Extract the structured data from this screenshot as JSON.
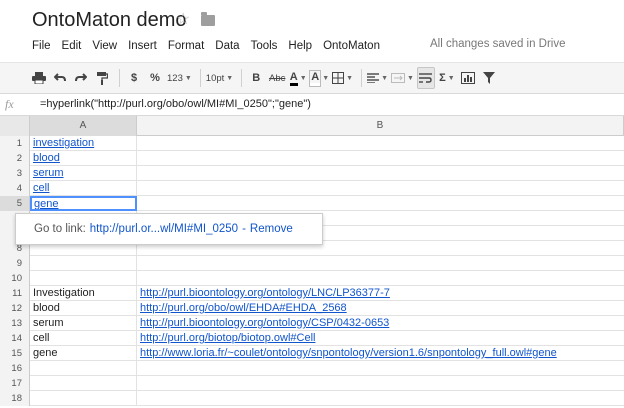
{
  "app": {
    "title": "OntoMaton demo",
    "save_status": "All changes saved in Drive"
  },
  "menu": [
    "File",
    "Edit",
    "View",
    "Insert",
    "Format",
    "Data",
    "Tools",
    "Help",
    "OntoMaton"
  ],
  "toolbar": {
    "currency": "$",
    "percent": "%",
    "number_format": "123",
    "font_size": "10pt",
    "bold": "B",
    "strikethrough": "Abc",
    "text_color": "A",
    "fill_color": "A",
    "sum": "Σ"
  },
  "formula_bar": {
    "fx": "fx",
    "value": "=hyperlink(\"http://purl.org/obo/owl/MI#MI_0250\";\"gene\")"
  },
  "columns": [
    "A",
    "B"
  ],
  "rows": [
    {
      "num": "1",
      "a": "investigation",
      "a_link": true,
      "b": "",
      "b_link": false
    },
    {
      "num": "2",
      "a": "blood",
      "a_link": true,
      "b": "",
      "b_link": false
    },
    {
      "num": "3",
      "a": "serum",
      "a_link": true,
      "b": "",
      "b_link": false
    },
    {
      "num": "4",
      "a": "cell",
      "a_link": true,
      "b": "",
      "b_link": false
    },
    {
      "num": "5",
      "a": "gene",
      "a_link": true,
      "b": "",
      "b_link": false,
      "selected": true
    },
    {
      "num": "6",
      "a": "",
      "a_link": false,
      "b": "",
      "b_link": false
    },
    {
      "num": "7",
      "a": "",
      "a_link": false,
      "b": "",
      "b_link": false
    },
    {
      "num": "8",
      "a": "",
      "a_link": false,
      "b": "",
      "b_link": false
    },
    {
      "num": "9",
      "a": "",
      "a_link": false,
      "b": "",
      "b_link": false
    },
    {
      "num": "10",
      "a": "",
      "a_link": false,
      "b": "",
      "b_link": false
    },
    {
      "num": "11",
      "a": "Investigation",
      "a_link": false,
      "b": "http://purl.bioontology.org/ontology/LNC/LP36377-7",
      "b_link": true
    },
    {
      "num": "12",
      "a": "blood",
      "a_link": false,
      "b": "http://purl.org/obo/owl/EHDA#EHDA_2568",
      "b_link": true
    },
    {
      "num": "13",
      "a": "serum",
      "a_link": false,
      "b": "http://purl.bioontology.org/ontology/CSP/0432-0653",
      "b_link": true
    },
    {
      "num": "14",
      "a": "cell",
      "a_link": false,
      "b": "http://purl.org/biotop/biotop.owl#Cell",
      "b_link": true
    },
    {
      "num": "15",
      "a": "gene",
      "a_link": false,
      "b": "http://www.loria.fr/~coulet/ontology/snpontology/version1.6/snpontology_full.owl#gene",
      "b_link": true
    },
    {
      "num": "16",
      "a": "",
      "a_link": false,
      "b": "",
      "b_link": false
    },
    {
      "num": "17",
      "a": "",
      "a_link": false,
      "b": "",
      "b_link": false
    },
    {
      "num": "18",
      "a": "",
      "a_link": false,
      "b": "",
      "b_link": false
    }
  ],
  "link_popup": {
    "label": "Go to link:",
    "url": "http://purl.or...wl/MI#MI_0250",
    "separator": "-",
    "remove": "Remove"
  },
  "colors": {
    "link": "#1155cc",
    "selection": "#4d90fe"
  }
}
